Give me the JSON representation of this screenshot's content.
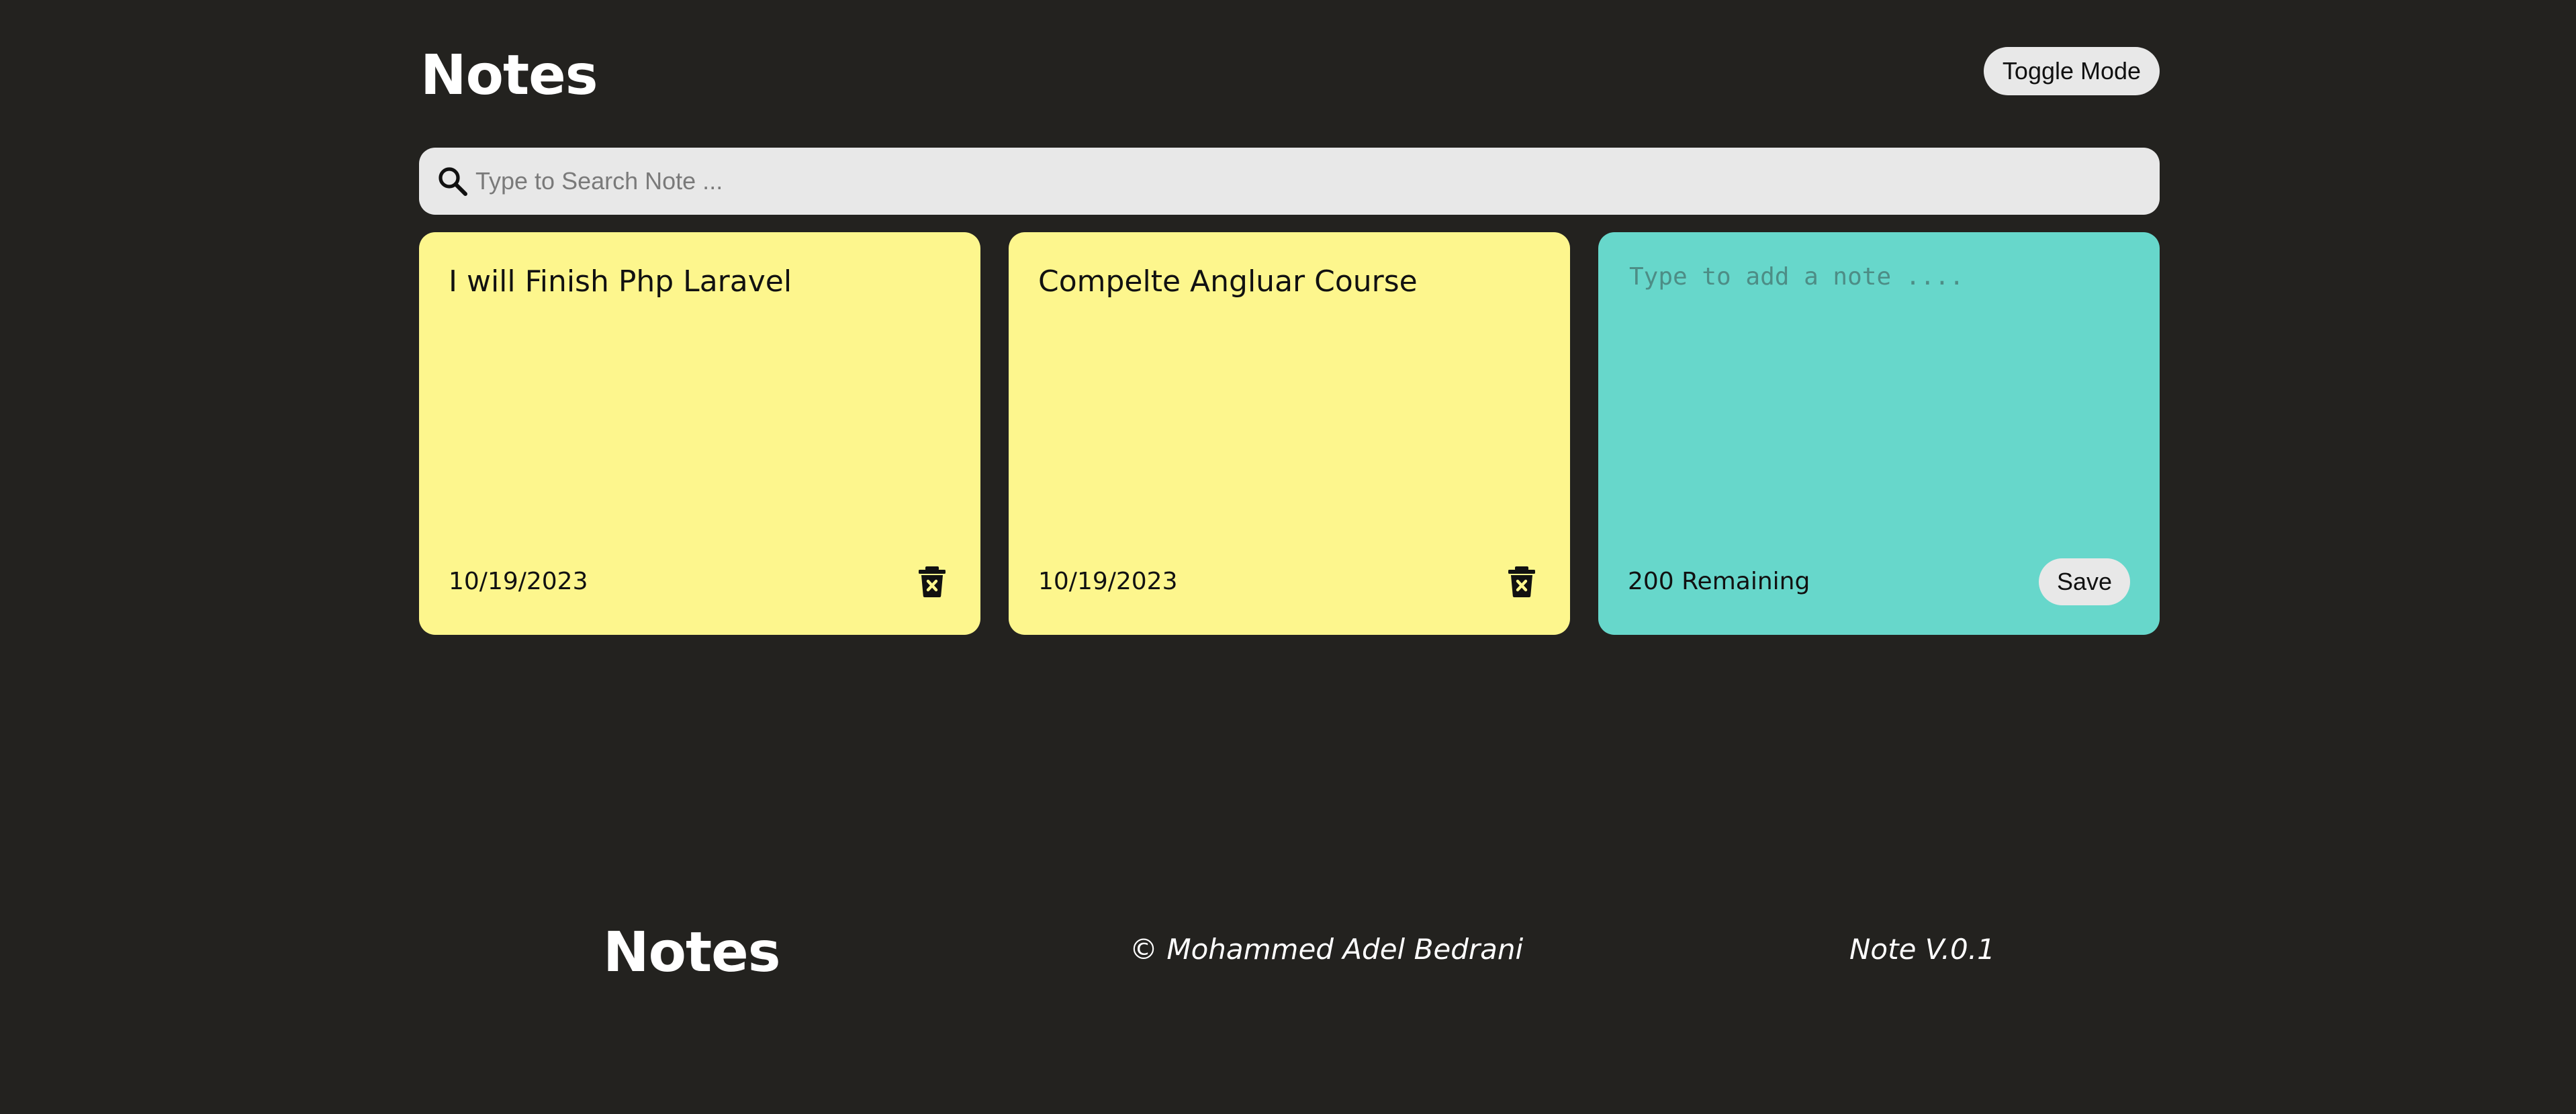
{
  "header": {
    "title": "Notes",
    "toggle_label": "Toggle Mode"
  },
  "search": {
    "icon": "search-icon",
    "placeholder": "Type to Search Note ...",
    "value": ""
  },
  "notes": [
    {
      "text": "I will Finish Php Laravel",
      "date": "10/19/2023",
      "delete_icon": "trash-x-icon",
      "color": "#fdf68d"
    },
    {
      "text": "Compelte Angluar Course",
      "date": "10/19/2023",
      "delete_icon": "trash-x-icon",
      "color": "#fdf68d"
    }
  ],
  "new_note": {
    "placeholder": "Type to add a note ....",
    "value": "",
    "remaining": "200 Remaining",
    "save_label": "Save",
    "color": "#67d7cb"
  },
  "footer": {
    "title": "Notes",
    "copyright": "© Mohammed Adel Bedrani",
    "version": "Note V.0.1"
  },
  "colors": {
    "background": "#23221f",
    "note_yellow": "#fdf68d",
    "note_teal": "#67d7cb",
    "button_bg": "#e8e8e8"
  }
}
